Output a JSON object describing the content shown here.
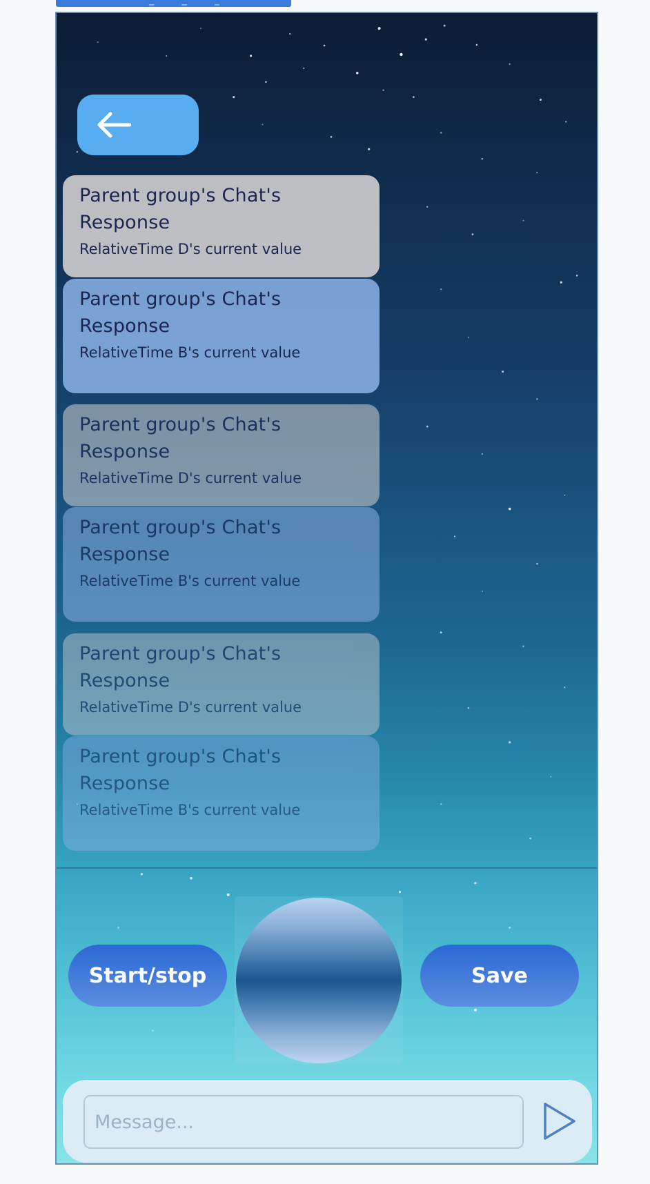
{
  "header": {
    "tab_label": "_ _ _"
  },
  "toolbar": {
    "back_icon": "arrow-left-icon"
  },
  "messages": [
    {
      "title": "Parent group's Chat's Response",
      "time": "RelativeTime D's current value",
      "style": "grey"
    },
    {
      "title": "Parent group's Chat's Response",
      "time": "RelativeTime B's current value",
      "style": "blue"
    },
    {
      "title": "Parent group's Chat's Response",
      "time": "RelativeTime D's current value",
      "style": "grey"
    },
    {
      "title": "Parent group's Chat's Response",
      "time": "RelativeTime B's current value",
      "style": "blue"
    },
    {
      "title": "Parent group's Chat's Response",
      "time": "RelativeTime D's current value",
      "style": "grey"
    },
    {
      "title": "Parent group's Chat's Response",
      "time": "RelativeTime B's current value",
      "style": "blue"
    }
  ],
  "controls": {
    "start_stop_label": "Start/stop",
    "save_label": "Save"
  },
  "composer": {
    "placeholder": "Message...",
    "value": "",
    "send_icon": "send-icon"
  },
  "colors": {
    "accent": "#2a68d4",
    "back_button": "#58adf0",
    "message_grey": "#dad6d4",
    "message_blue": "#8cb2e6",
    "text_dark": "#1a2650",
    "composer_bg": "#dcecf5"
  }
}
